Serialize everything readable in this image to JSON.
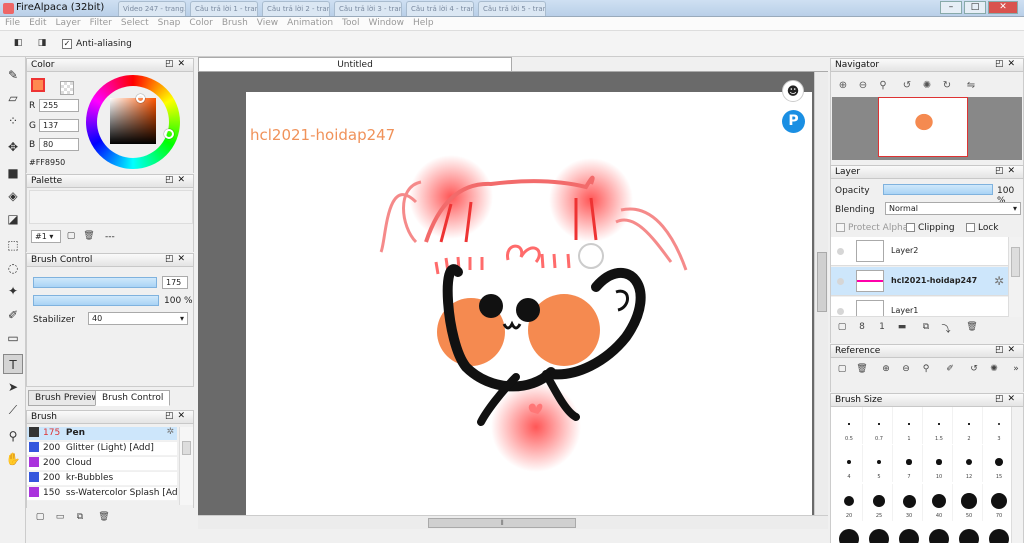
{
  "window": {
    "title": "FireAlpaca (32bit)",
    "background_tabs": [
      "Video 247 - trang...",
      "Câu trả lời 1 - trang...",
      "Câu trả lời 2 - trang...",
      "Câu trả lời 3 - trang...",
      "Câu trả lời 4 - trang...",
      "Câu trả lời 5 - trang..."
    ]
  },
  "menu": [
    "File",
    "Edit",
    "Layer",
    "Filter",
    "Select",
    "Snap",
    "Color",
    "Brush",
    "View",
    "Animation",
    "Tool",
    "Window",
    "Help"
  ],
  "toolbar": {
    "anti_aliasing_label": "Anti-aliasing",
    "anti_aliasing_checked": true
  },
  "color_panel": {
    "title": "Color",
    "r_label": "R",
    "r_value": "255",
    "g_label": "G",
    "g_value": "137",
    "b_label": "B",
    "b_value": "80",
    "hex": "#FF8950",
    "current_color": "#FF8950"
  },
  "palette_panel": {
    "title": "Palette",
    "selector": "#1",
    "more": "---"
  },
  "brush_control_panel": {
    "title": "Brush Control",
    "size_value": "175",
    "opacity_value": "100 %",
    "stabilizer_label": "Stabilizer",
    "stabilizer_value": "40"
  },
  "bottom_tabs": [
    "Brush Preview",
    "Brush Control"
  ],
  "brush_panel": {
    "title": "Brush",
    "items": [
      {
        "size": "175",
        "name": "Pen",
        "color": "#333333"
      },
      {
        "size": "200",
        "name": "Glitter (Light) [Add]",
        "color": "#3355dd"
      },
      {
        "size": "200",
        "name": "Cloud",
        "color": "#aa33dd"
      },
      {
        "size": "200",
        "name": "kr-Bubbles",
        "color": "#3355dd"
      },
      {
        "size": "150",
        "name": "ss-Watercolor Splash [Add]",
        "color": "#aa33dd"
      }
    ]
  },
  "document": {
    "tab_title": "Untitled",
    "watermark_text": "hcl2021-hoidap247"
  },
  "navigator": {
    "title": "Navigator"
  },
  "layer_panel": {
    "title": "Layer",
    "opacity_label": "Opacity",
    "opacity_value": "100 %",
    "opacity_fraction": 1.0,
    "blending_label": "Blending",
    "blending_value": "Normal",
    "protect_alpha_label": "Protect Alpha",
    "clipping_label": "Clipping",
    "lock_label": "Lock",
    "layers": [
      "Layer2",
      "hcl2021-hoidap247",
      "Layer1"
    ]
  },
  "reference_panel": {
    "title": "Reference"
  },
  "brush_size_panel": {
    "title": "Brush Size",
    "rows": [
      [
        "0.5",
        "0.7",
        "1",
        "1.5",
        "2",
        "3"
      ],
      [
        "4",
        "5",
        "7",
        "10",
        "12",
        "15"
      ],
      [
        "20",
        "25",
        "30",
        "40",
        "50",
        "70"
      ]
    ]
  }
}
